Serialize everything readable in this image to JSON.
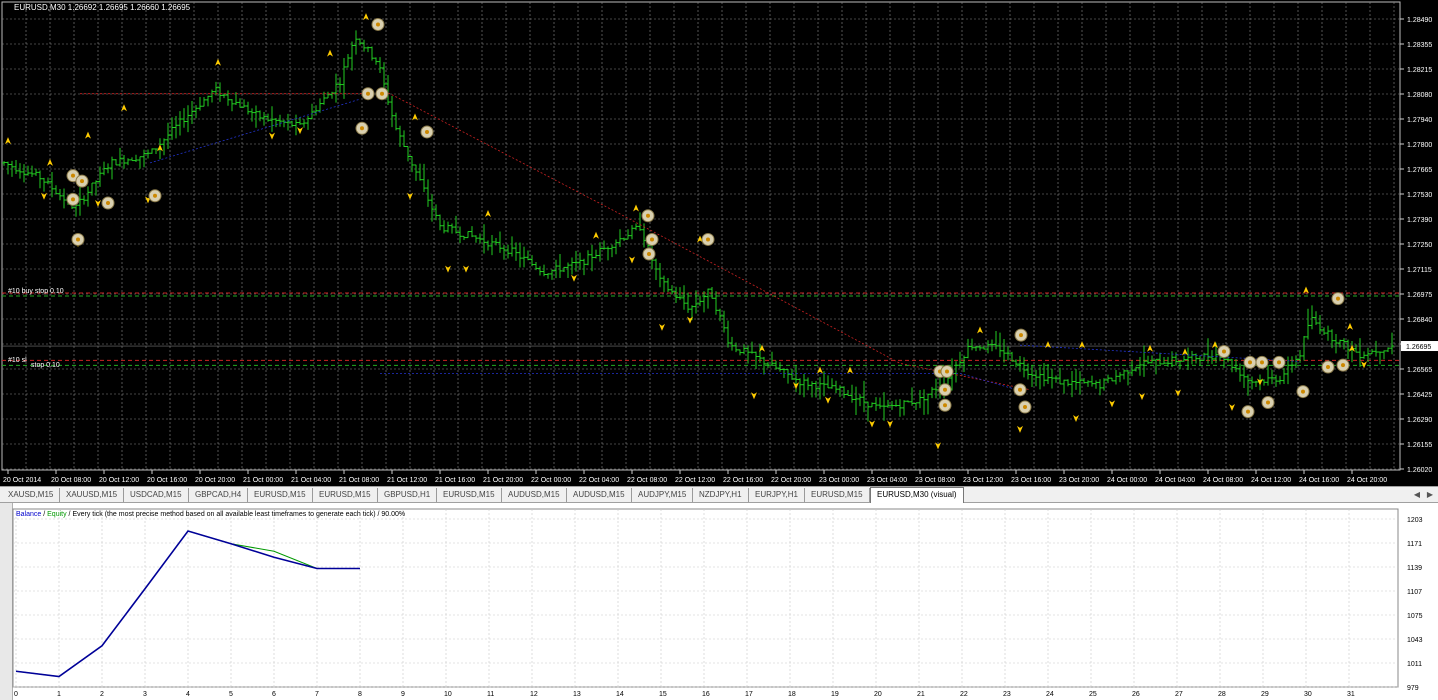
{
  "chart": {
    "title": "EURUSD,M30  1.26692 1.26695 1.26660 1.26695",
    "price_levels": [
      "1.28490",
      "1.28355",
      "1.28215",
      "1.28080",
      "1.27940",
      "1.27800",
      "1.27665",
      "1.27530",
      "1.27390",
      "1.27250",
      "1.27115",
      "1.26975",
      "1.26840",
      "1.26695",
      "1.26565",
      "1.26425",
      "1.26290",
      "1.26155",
      "1.26020"
    ],
    "current_price": "1.26695",
    "time_labels": [
      "20 Oct 2014",
      "20 Oct 08:00",
      "20 Oct 12:00",
      "20 Oct 16:00",
      "20 Oct 20:00",
      "21 Oct 00:00",
      "21 Oct 04:00",
      "21 Oct 08:00",
      "21 Oct 12:00",
      "21 Oct 16:00",
      "21 Oct 20:00",
      "22 Oct 00:00",
      "22 Oct 04:00",
      "22 Oct 08:00",
      "22 Oct 12:00",
      "22 Oct 16:00",
      "22 Oct 20:00",
      "23 Oct 00:00",
      "23 Oct 04:00",
      "23 Oct 08:00",
      "23 Oct 12:00",
      "23 Oct 16:00",
      "23 Oct 20:00",
      "24 Oct 00:00",
      "24 Oct 04:00",
      "24 Oct 08:00",
      "24 Oct 12:00",
      "24 Oct 16:00",
      "24 Oct 20:00"
    ],
    "order_buy_stop": "#10 buy stop 0.10",
    "order_sl": "#10 sl",
    "order_stop": "stop 0.10",
    "colors": {
      "background": "#000000",
      "grid": "#8a8a8a",
      "bars": "#22cc22",
      "axis_text": "#ffffff",
      "signal": "#ffcc00"
    }
  },
  "tabs": [
    "XAUSD,M15",
    "XAUUSD,M15",
    "USDCAD,M15",
    "GBPCAD,H4",
    "EURUSD,M15",
    "EURUSD,M15",
    "GBPUSD,H1",
    "EURUSD,M15",
    "AUDUSD,M15",
    "AUDUSD,M15",
    "AUDJPY,M15",
    "NZDJPY,H1",
    "EURJPY,H1",
    "EURUSD,M15",
    "EURUSD,M30 (visual)"
  ],
  "active_tab": 14,
  "tester": {
    "balance_label": "Balance",
    "separator": " / ",
    "equity_label": "Equity",
    "description": " / Every tick (the most precise method based on all available least timeframes to generate each tick) / 90.00%",
    "y_labels": [
      "1203",
      "1171",
      "1139",
      "1107",
      "1075",
      "1043",
      "1011",
      "979"
    ],
    "x_labels": [
      "0",
      "1",
      "2",
      "3",
      "4",
      "5",
      "6",
      "7",
      "8",
      "9",
      "10",
      "11",
      "12",
      "13",
      "14",
      "15",
      "16",
      "17",
      "18",
      "19",
      "20",
      "21",
      "22",
      "23",
      "24",
      "25",
      "26",
      "27",
      "28",
      "29",
      "30",
      "31"
    ],
    "chart_data": {
      "type": "line",
      "x": [
        0,
        1,
        2,
        3,
        4,
        5,
        6,
        7,
        8
      ],
      "ylim": [
        979,
        1203
      ],
      "series": [
        {
          "name": "Balance",
          "color": "#000099",
          "values": [
            1000,
            993,
            1034,
            1110,
            1187,
            1170,
            1152,
            1137,
            1137
          ]
        },
        {
          "name": "Equity",
          "color": "#009900",
          "values": [
            1000,
            993,
            1034,
            1110,
            1187,
            1170,
            1160,
            1137,
            1137
          ]
        }
      ]
    }
  }
}
